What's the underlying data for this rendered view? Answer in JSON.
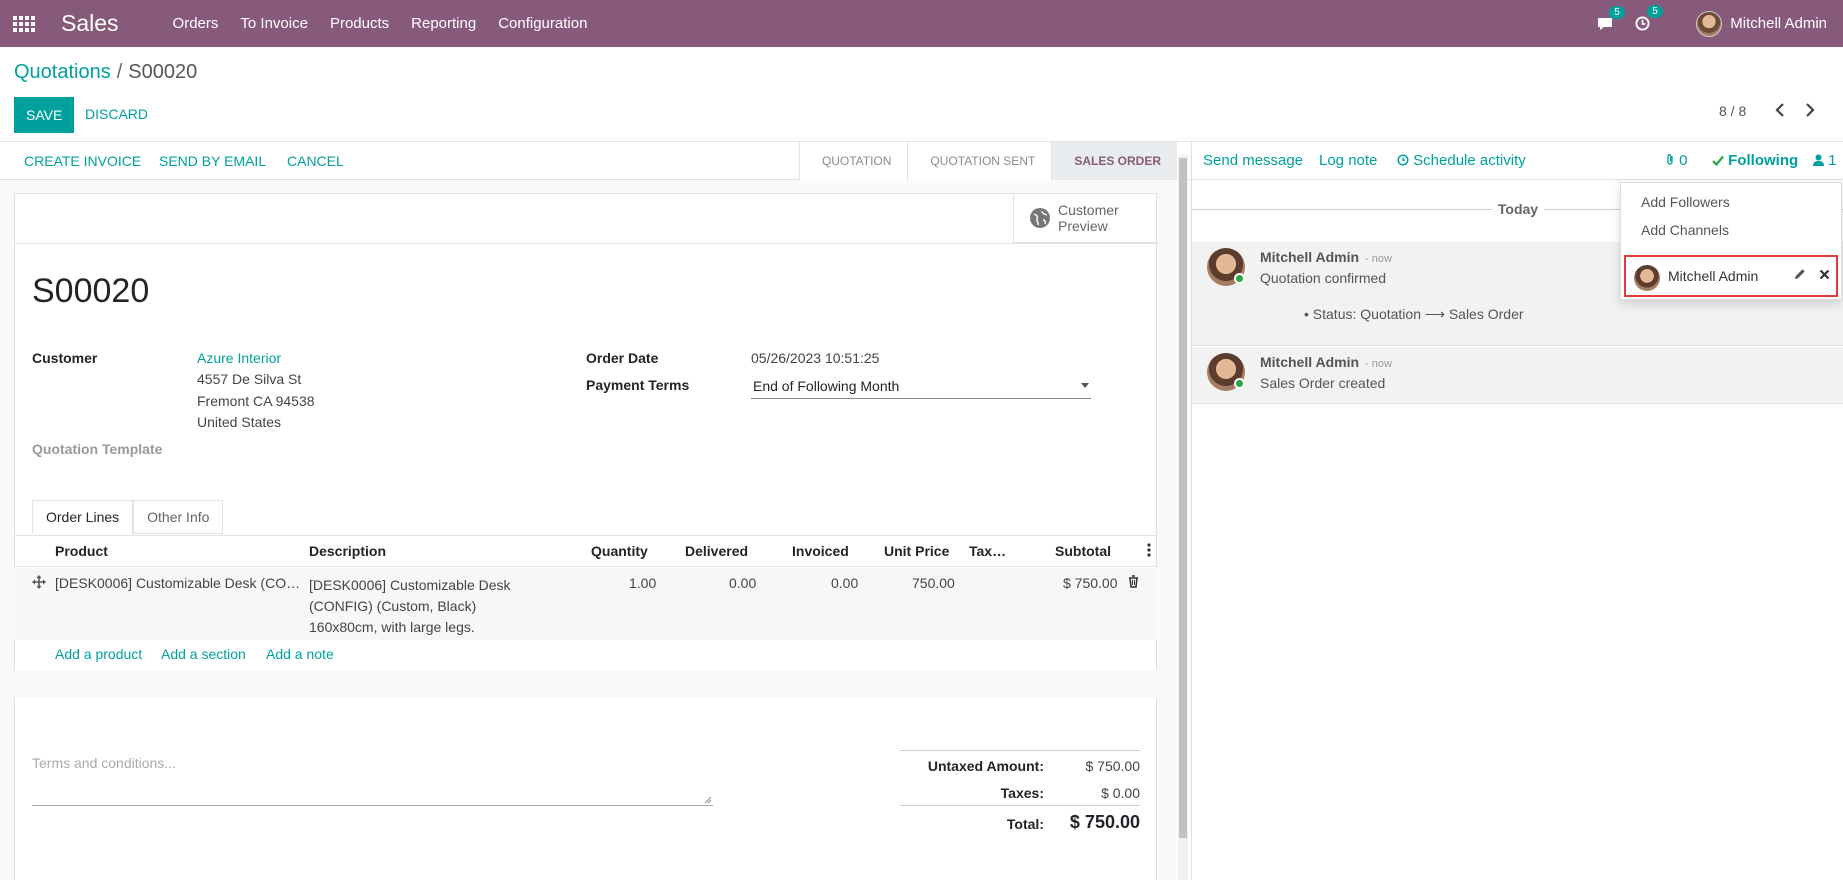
{
  "nav": {
    "brand": "Sales",
    "menu": [
      "Orders",
      "To Invoice",
      "Products",
      "Reporting",
      "Configuration"
    ],
    "messages_count": "5",
    "activities_count": "5",
    "user_name": "Mitchell Admin"
  },
  "breadcrumb": {
    "parent": "Quotations",
    "separator": "/",
    "current": "S00020"
  },
  "actions": {
    "save": "SAVE",
    "discard": "DISCARD"
  },
  "pager": {
    "value": "8 / 8"
  },
  "statusbar": {
    "buttons": [
      "CREATE INVOICE",
      "SEND BY EMAIL",
      "CANCEL"
    ],
    "stages": [
      "QUOTATION",
      "QUOTATION SENT",
      "SALES ORDER"
    ],
    "active_stage": "SALES ORDER"
  },
  "form": {
    "customer_preview": [
      "Customer",
      "Preview"
    ],
    "title": "S00020",
    "customer_label": "Customer",
    "customer_name": "Azure Interior",
    "address": [
      "4557 De Silva St",
      "Fremont CA 94538",
      "United States"
    ],
    "quotation_template_label": "Quotation Template",
    "order_date_label": "Order Date",
    "order_date": "05/26/2023 10:51:25",
    "payment_terms_label": "Payment Terms",
    "payment_terms": "End of Following Month"
  },
  "tabs": [
    "Order Lines",
    "Other Info"
  ],
  "table": {
    "headers": [
      "Product",
      "Description",
      "Quantity",
      "Delivered",
      "Invoiced",
      "Unit Price",
      "Tax…",
      "Subtotal"
    ],
    "rows": [
      {
        "product": "[DESK0006] Customizable Desk (CO…",
        "description": [
          "[DESK0006] Customizable Desk",
          "(CONFIG) (Custom, Black)",
          "160x80cm, with large legs."
        ],
        "quantity": "1.00",
        "delivered": "0.00",
        "invoiced": "0.00",
        "unit_price": "750.00",
        "subtotal": "$ 750.00"
      }
    ],
    "add_links": [
      "Add a product",
      "Add a section",
      "Add a note"
    ]
  },
  "terms": {
    "placeholder": "Terms and conditions..."
  },
  "totals": {
    "untaxed_label": "Untaxed Amount:",
    "untaxed": "$ 750.00",
    "taxes_label": "Taxes:",
    "taxes": "$ 0.00",
    "total_label": "Total:",
    "total": "$ 750.00"
  },
  "chatter": {
    "send_message": "Send message",
    "log_note": "Log note",
    "schedule_activity": "Schedule activity",
    "attachments": "0",
    "following": "Following",
    "followers_count": "1",
    "today": "Today",
    "messages": [
      {
        "author": "Mitchell Admin",
        "time": "- now",
        "body": "Quotation confirmed",
        "detail": "Status: Quotation ⟶ Sales Order"
      },
      {
        "author": "Mitchell Admin",
        "time": "- now",
        "body": "Sales Order created"
      }
    ]
  },
  "followers_dropdown": {
    "add_followers": "Add Followers",
    "add_channels": "Add Channels",
    "follower_name": "Mitchell Admin"
  },
  "colors": {
    "primary": "#875a7b",
    "accent": "#00a09d",
    "highlight": "#e03b3b"
  }
}
